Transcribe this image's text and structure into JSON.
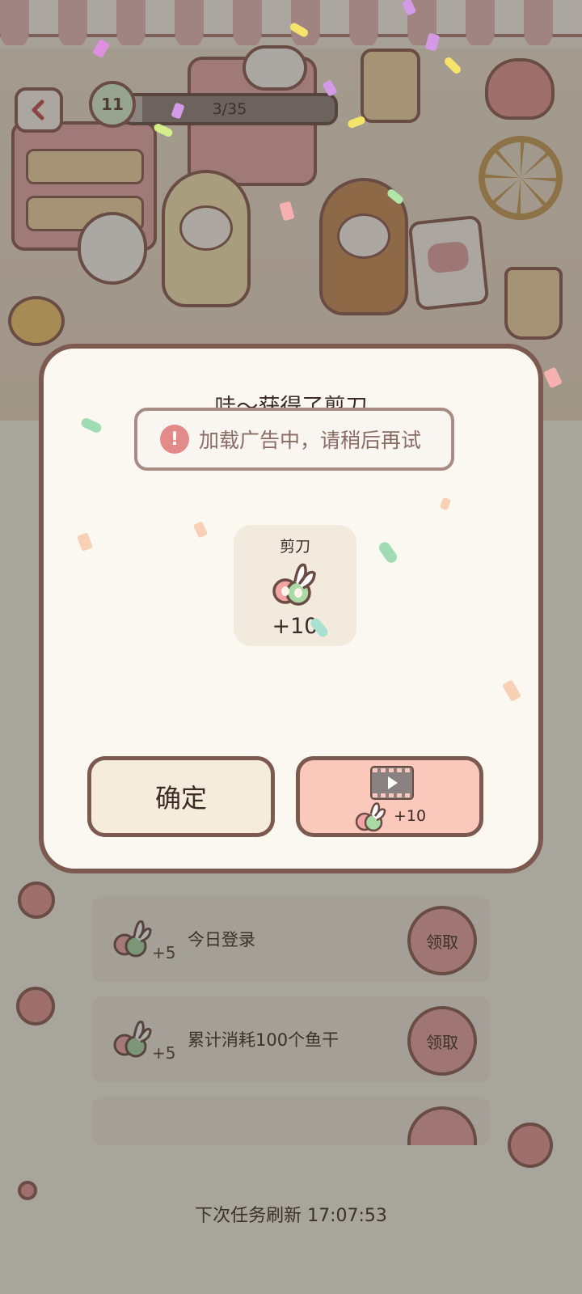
{
  "hud": {
    "level": "11",
    "progress_text": "3/35",
    "progress_fraction": 0.0857,
    "back_icon": "chevron-left-icon"
  },
  "dialog": {
    "title": "哇～获得了剪刀",
    "toast_icon": "exclamation-icon",
    "toast_text": "加载广告中，请稍后再试",
    "item": {
      "name": "剪刀",
      "icon": "scissors-icon",
      "count": "+10"
    },
    "confirm_label": "确定",
    "ad_button": {
      "icon": "video-film-icon",
      "reward_icon": "scissors-icon",
      "reward_count": "+10"
    }
  },
  "tasks": [
    {
      "title": "今日登录",
      "reward": "+5",
      "claim_label": "领取"
    },
    {
      "title": "累计消耗100个鱼干",
      "reward": "+5",
      "claim_label": "领取"
    }
  ],
  "refresh_text": "下次任务刷新 17:07:53",
  "colors": {
    "accent_pink": "#fbc8bc",
    "outline_brown": "#7c5a50",
    "dialog_bg": "#fbf8f2"
  }
}
